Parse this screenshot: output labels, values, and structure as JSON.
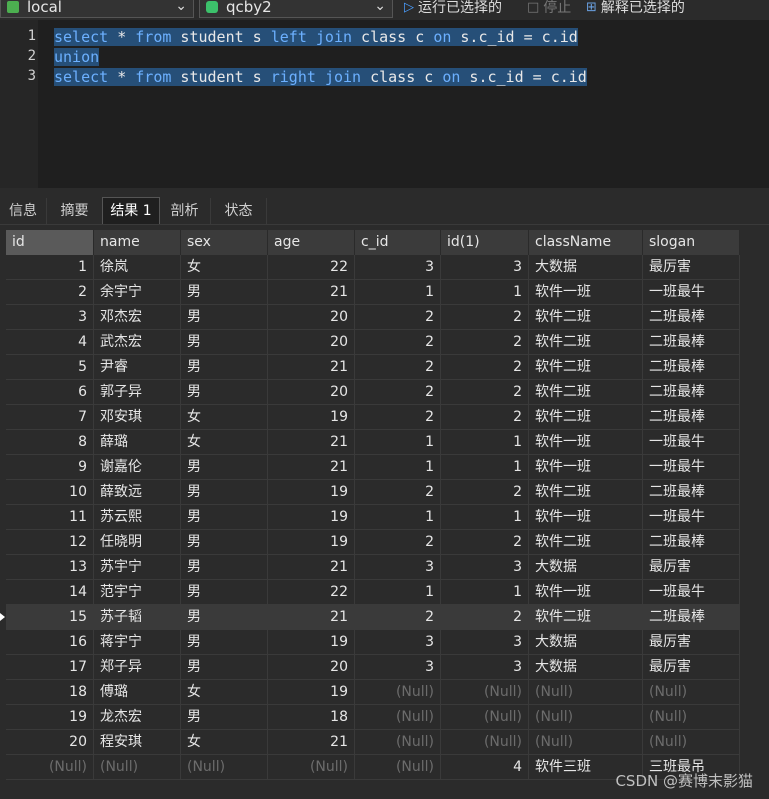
{
  "toolbar": {
    "connection": "local",
    "database": "qcby2",
    "run_selected": "运行已选择的",
    "stop": "停止",
    "explain_selected": "解释已选择的",
    "connection_color": "#4caf50",
    "database_color": "#3cc16b"
  },
  "editor": {
    "line_numbers": [
      "1",
      "2",
      "3"
    ],
    "lines": [
      [
        "select",
        " * ",
        "from",
        " student s ",
        "left",
        " ",
        "join",
        " class c ",
        "on",
        " s.c_id = c.id"
      ],
      [
        "union"
      ],
      [
        "select",
        " * ",
        "from",
        " student s ",
        "right",
        " ",
        "join",
        " class c ",
        "on",
        " s.c_id = c.id"
      ]
    ]
  },
  "tabs": [
    "信息",
    "摘要",
    "结果 1",
    "剖析",
    "状态"
  ],
  "active_tab": 2,
  "table": {
    "columns": [
      "id",
      "name",
      "sex",
      "age",
      "c_id",
      "id(1)",
      "className",
      "slogan"
    ],
    "rows": [
      [
        "1",
        "徐岚",
        "女",
        "22",
        "3",
        "3",
        "大数据",
        "最厉害"
      ],
      [
        "2",
        "余宇宁",
        "男",
        "21",
        "1",
        "1",
        "软件一班",
        "一班最牛"
      ],
      [
        "3",
        "邓杰宏",
        "男",
        "20",
        "2",
        "2",
        "软件二班",
        "二班最棒"
      ],
      [
        "4",
        "武杰宏",
        "男",
        "20",
        "2",
        "2",
        "软件二班",
        "二班最棒"
      ],
      [
        "5",
        "尹睿",
        "男",
        "21",
        "2",
        "2",
        "软件二班",
        "二班最棒"
      ],
      [
        "6",
        "郭子异",
        "男",
        "20",
        "2",
        "2",
        "软件二班",
        "二班最棒"
      ],
      [
        "7",
        "邓安琪",
        "女",
        "19",
        "2",
        "2",
        "软件二班",
        "二班最棒"
      ],
      [
        "8",
        "薛璐",
        "女",
        "21",
        "1",
        "1",
        "软件一班",
        "一班最牛"
      ],
      [
        "9",
        "谢嘉伦",
        "男",
        "21",
        "1",
        "1",
        "软件一班",
        "一班最牛"
      ],
      [
        "10",
        "薛致远",
        "男",
        "19",
        "2",
        "2",
        "软件二班",
        "二班最棒"
      ],
      [
        "11",
        "苏云熙",
        "男",
        "19",
        "1",
        "1",
        "软件一班",
        "一班最牛"
      ],
      [
        "12",
        "任晓明",
        "男",
        "19",
        "2",
        "2",
        "软件二班",
        "二班最棒"
      ],
      [
        "13",
        "苏宇宁",
        "男",
        "21",
        "3",
        "3",
        "大数据",
        "最厉害"
      ],
      [
        "14",
        "范宇宁",
        "男",
        "22",
        "1",
        "1",
        "软件一班",
        "一班最牛"
      ],
      [
        "15",
        "苏子韬",
        "男",
        "21",
        "2",
        "2",
        "软件二班",
        "二班最棒"
      ],
      [
        "16",
        "蒋宇宁",
        "男",
        "19",
        "3",
        "3",
        "大数据",
        "最厉害"
      ],
      [
        "17",
        "郑子异",
        "男",
        "20",
        "3",
        "3",
        "大数据",
        "最厉害"
      ],
      [
        "18",
        "傅璐",
        "女",
        "19",
        "(Null)",
        "(Null)",
        "(Null)",
        "(Null)"
      ],
      [
        "19",
        "龙杰宏",
        "男",
        "18",
        "(Null)",
        "(Null)",
        "(Null)",
        "(Null)"
      ],
      [
        "20",
        "程安琪",
        "女",
        "21",
        "(Null)",
        "(Null)",
        "(Null)",
        "(Null)"
      ],
      [
        "(Null)",
        "(Null)",
        "(Null)",
        "(Null)",
        "(Null)",
        "4",
        "软件三班",
        "三班最吊"
      ]
    ],
    "current_row": 14
  },
  "watermark": "CSDN @赛博末影猫"
}
